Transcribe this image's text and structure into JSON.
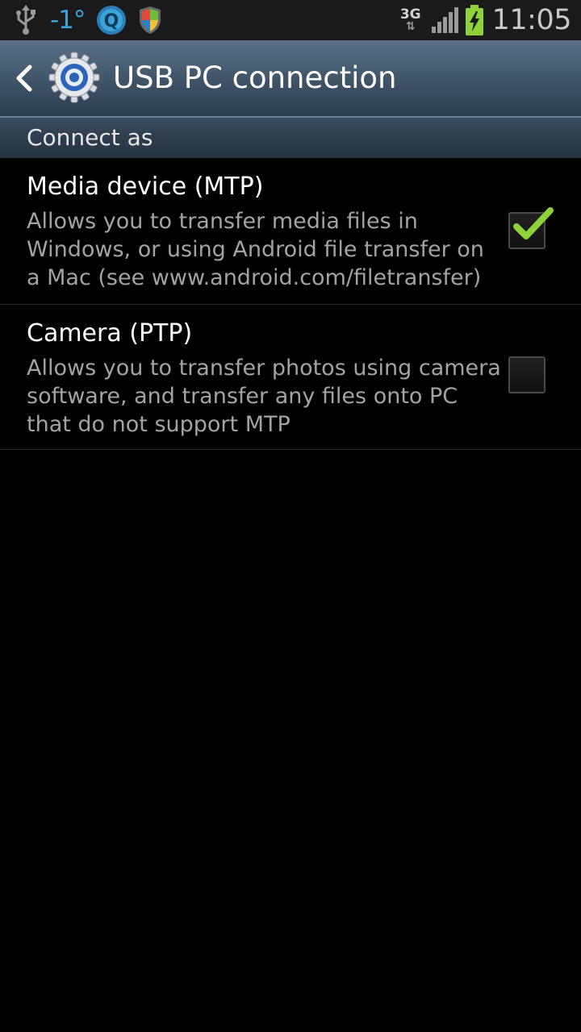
{
  "status_bar": {
    "icons_left": [
      "usb-icon",
      "temperature-icon",
      "q-app-icon",
      "security-shield-icon"
    ],
    "temperature": "-1°",
    "network_type": "3G",
    "network_arrows": "⇅",
    "icons_right": [
      "network-3g-icon",
      "signal-strength-icon",
      "battery-charging-icon"
    ],
    "time": "11:05",
    "colors": {
      "temperature": "#3aa5d8",
      "battery": "#8fd13a"
    }
  },
  "action_bar": {
    "back_icon": "chevron-left-icon",
    "app_icon": "settings-gear-icon",
    "title": "USB PC connection"
  },
  "section": {
    "header": "Connect as"
  },
  "preferences": [
    {
      "title": "Media device (MTP)",
      "summary": "Allows you to transfer media files in Windows, or using Android file transfer on a Mac (see www.android.com/filetransfer)",
      "checked": true
    },
    {
      "title": "Camera (PTP)",
      "summary": "Allows you to transfer photos using camera software, and transfer any files onto PC that do not support MTP",
      "checked": false
    }
  ],
  "colors": {
    "accent_check": "#8fd13a",
    "summary_text": "#a3a3a3",
    "background": "#000000"
  }
}
